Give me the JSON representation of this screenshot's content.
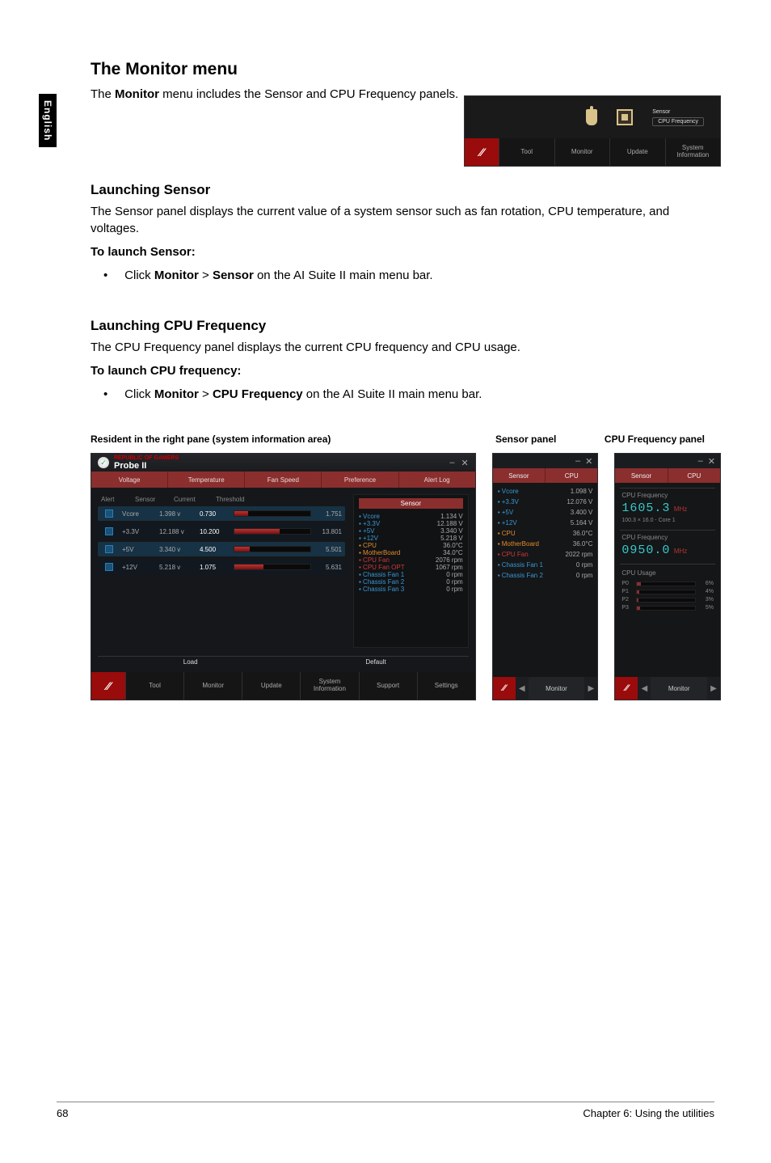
{
  "side_tab": "English",
  "h1": "The Monitor menu",
  "intro_parts": [
    "The ",
    "Monitor",
    " menu includes the Sensor and CPU Frequency panels."
  ],
  "top_menubar": {
    "sensor_group_label": "Sensor",
    "cpu_group_label": "CPU Frequency",
    "bottom_items": [
      "Tool",
      "Monitor",
      "Update",
      "System Information"
    ]
  },
  "sec1_title": "Launching Sensor",
  "sec1_p": "The Sensor panel displays the current value of a system sensor such as fan rotation, CPU temperature, and voltages.",
  "sec1_bold": "To launch Sensor:",
  "sec1_bullet_parts": [
    "Click ",
    "Monitor",
    " > ",
    "Sensor",
    " on the AI Suite II main menu bar."
  ],
  "sec2_title": "Launching CPU Frequency",
  "sec2_p": "The CPU Frequency panel displays the current CPU frequency and CPU usage.",
  "sec2_bold": "To launch CPU frequency:",
  "sec2_bullet_parts": [
    "Click ",
    "Monitor",
    " > ",
    "CPU Frequency",
    " on the AI Suite II main menu bar."
  ],
  "captions": {
    "c1": "Resident in the right pane (system information area)",
    "c2": "Sensor panel",
    "c3": "CPU Frequency panel"
  },
  "probe_panel": {
    "title_brand": "REPUBLIC OF GAMERS",
    "title_name": "Probe II",
    "tabs": [
      "Voltage",
      "Temperature",
      "Fan Speed",
      "Preference",
      "Alert Log"
    ],
    "left_headers": [
      "Alert",
      "Sensor",
      "Current",
      "Threshold"
    ],
    "rows": [
      {
        "sensor": "Vcore",
        "current": "1.398 v",
        "threshold": "0.730",
        "pct": 18,
        "limit": "1.751"
      },
      {
        "sensor": "+3.3V",
        "current": "12.188 v",
        "threshold": "10.200",
        "pct": 60,
        "limit": "13.801"
      },
      {
        "sensor": "+5V",
        "current": "3.340 v",
        "threshold": "4.500",
        "pct": 20,
        "limit": "5.501"
      },
      {
        "sensor": "+12V",
        "current": "5.218 v",
        "threshold": "1.075",
        "pct": 38,
        "limit": "5.631"
      }
    ],
    "subtabs": [
      "Load",
      "Default"
    ],
    "right_header": "Sensor",
    "right_rows": [
      {
        "label": "Vcore",
        "value": "1.134 V",
        "cls": "lab"
      },
      {
        "label": "+3.3V",
        "value": "12.188 V",
        "cls": "lab"
      },
      {
        "label": "+5V",
        "value": "3.340 V",
        "cls": "lab"
      },
      {
        "label": "+12V",
        "value": "5.218 V",
        "cls": "lab"
      },
      {
        "label": "CPU",
        "value": "36.0°C",
        "cls": "lab orange"
      },
      {
        "label": "MotherBoard",
        "value": "34.0°C",
        "cls": "lab orange"
      },
      {
        "label": "CPU Fan",
        "value": "2076 rpm",
        "cls": "lab red"
      },
      {
        "label": "CPU Fan OPT",
        "value": "1067 rpm",
        "cls": "lab red"
      },
      {
        "label": "Chassis Fan 1",
        "value": "0 rpm",
        "cls": "lab"
      },
      {
        "label": "Chassis Fan 2",
        "value": "0 rpm",
        "cls": "lab"
      },
      {
        "label": "Chassis Fan 3",
        "value": "0 rpm",
        "cls": "lab"
      }
    ],
    "bottom_items": [
      "Tool",
      "Monitor",
      "Update",
      "System Information",
      "Support",
      "Settings"
    ]
  },
  "sensor_panel": {
    "tabs": [
      "Sensor",
      "CPU"
    ],
    "rows": [
      {
        "label": "Vcore",
        "value": "1.098 V",
        "cls": "lab"
      },
      {
        "label": "+3.3V",
        "value": "12.076 V",
        "cls": "lab"
      },
      {
        "label": "+5V",
        "value": "3.400 V",
        "cls": "lab"
      },
      {
        "label": "+12V",
        "value": "5.164 V",
        "cls": "lab"
      },
      {
        "label": "CPU",
        "value": "36.0°C",
        "cls": "lab orange"
      },
      {
        "label": "MotherBoard",
        "value": "36.0°C",
        "cls": "lab orange"
      },
      {
        "label": "CPU Fan",
        "value": "2022 rpm",
        "cls": "lab red"
      },
      {
        "label": "Chassis Fan 1",
        "value": "0 rpm",
        "cls": "lab"
      },
      {
        "label": "Chassis Fan 2",
        "value": "0 rpm",
        "cls": "lab"
      }
    ],
    "tail_label": "Monitor"
  },
  "cpu_panel": {
    "tabs": [
      "Sensor",
      "CPU"
    ],
    "freq_title": "CPU Frequency",
    "freq_value": "1605.3",
    "freq_unit": "MHz",
    "freq_sub": "100.3 × 16.0   ⋅ Core 1",
    "ratio_title": "CPU Frequency",
    "ratio_value": "0950.0",
    "ratio_unit": "MHz",
    "usage_title": "CPU Usage",
    "cores": [
      {
        "name": "P0",
        "pct": 6
      },
      {
        "name": "P1",
        "pct": 4
      },
      {
        "name": "P2",
        "pct": 3
      },
      {
        "name": "P3",
        "pct": 5
      }
    ],
    "tail_label": "Monitor"
  },
  "footer": {
    "left": "68",
    "right": "Chapter 6: Using the utilities"
  }
}
